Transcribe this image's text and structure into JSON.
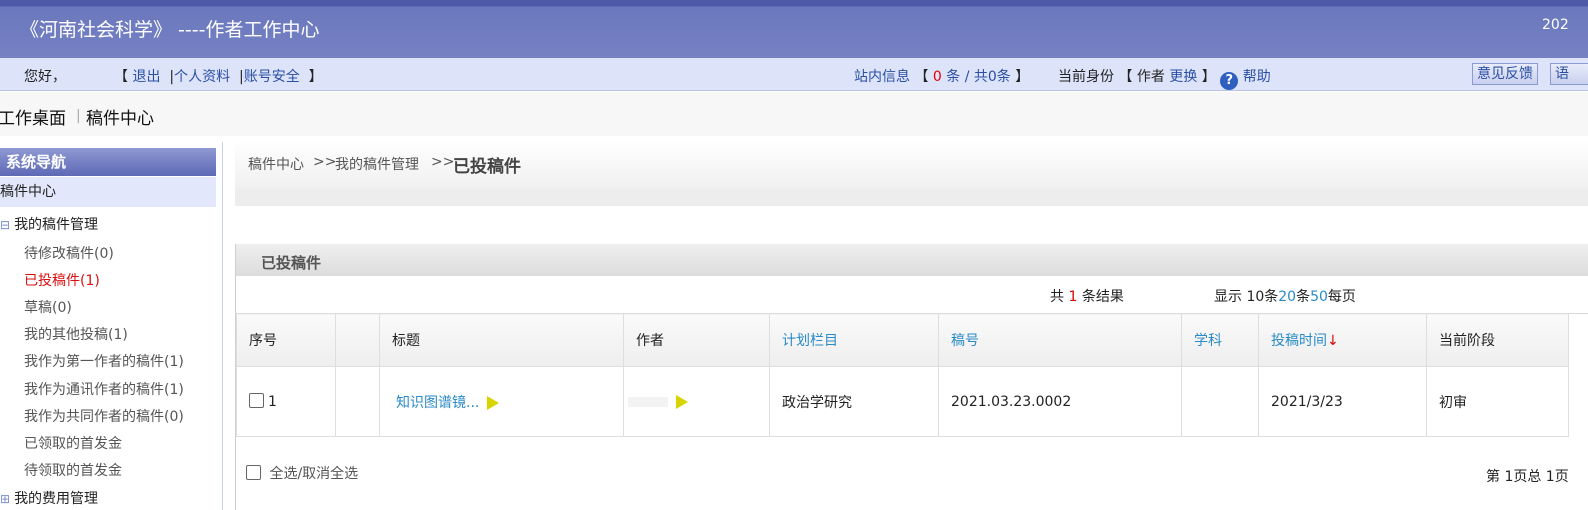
{
  "header": {
    "app_title": "《河南社会科学》 ----作者工作中心",
    "year_partial": "202"
  },
  "userbar": {
    "greeting": "您好，",
    "logout": "退出",
    "profile": "个人资料",
    "security": "账号安全",
    "inbox_label": "站内信息",
    "inbox_unread": "0",
    "inbox_total": "条 / 共0条",
    "identity_label": "当前身份",
    "identity_value": "作者",
    "identity_switch": "更换",
    "help": "帮助",
    "feedback": "意见反馈",
    "lang_partial": "语"
  },
  "tabs": {
    "desk": "工作桌面",
    "center": "稿件中心"
  },
  "sidebar": {
    "title": "系统导航",
    "current": "稿件中心",
    "group1": "我的稿件管理",
    "items": [
      {
        "label": "待修改稿件(0)"
      },
      {
        "label": "已投稿件(1)"
      },
      {
        "label": "草稿(0)"
      },
      {
        "label": "我的其他投稿(1)"
      },
      {
        "label": "我作为第一作者的稿件(1)"
      },
      {
        "label": "我作为通讯作者的稿件(1)"
      },
      {
        "label": "我作为共同作者的稿件(0)"
      },
      {
        "label": "已领取的首发金"
      },
      {
        "label": "待领取的首发金"
      }
    ],
    "group2": "我的费用管理"
  },
  "breadcrumb": {
    "c1": "稿件中心",
    "c2": "我的稿件管理",
    "c3": "已投稿件",
    "sep": ">>"
  },
  "panel": {
    "title": "已投稿件",
    "result_prefix": "共",
    "result_count": "1",
    "result_suffix": "条结果",
    "display_prefix": "显示 10条",
    "opt20": "20",
    "mid": "条",
    "opt50": "50",
    "display_suffix": "每页"
  },
  "table": {
    "headers": [
      "序号",
      "",
      "标题",
      "作者",
      "计划栏目",
      "稿号",
      "学科",
      "投稿时间",
      "当前阶段"
    ],
    "sort_arrow": "↓",
    "rows": [
      {
        "index": "1",
        "title": "知识图谱镜...",
        "author": "",
        "column": "政治学研究",
        "ms_no": "2021.03.23.0002",
        "subject": "",
        "date": "2021/3/23",
        "stage": "初审"
      }
    ]
  },
  "footer": {
    "select_all": "全选/取消全选",
    "pager": "第 1页总 1页"
  }
}
